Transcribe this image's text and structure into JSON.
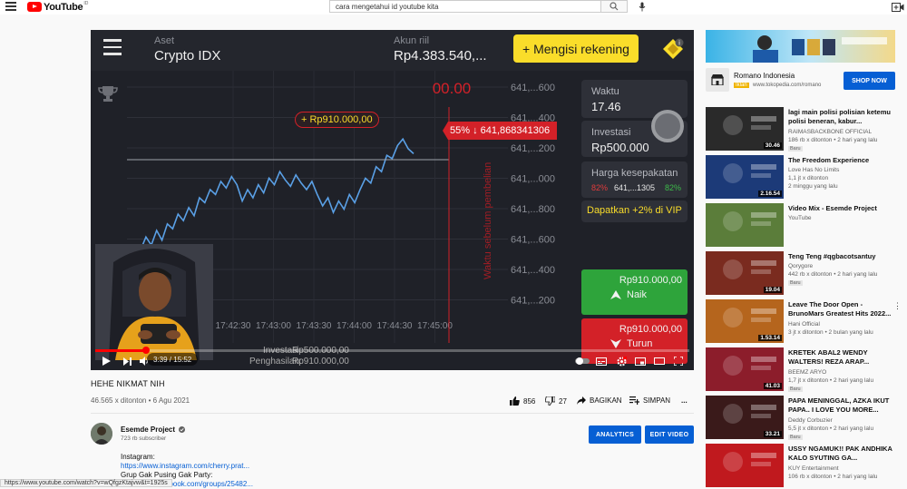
{
  "browser": {
    "status_url": "https://www.youtube.com/watch?v=wQfgzKtajvw&t=1925s"
  },
  "header": {
    "logo_text": "YouTube",
    "logo_sup": "ID",
    "search_value": "cara mengetahui id youtube kita"
  },
  "player": {
    "app": {
      "asset_label": "Aset",
      "asset_value": "Crypto IDX",
      "account_label": "Akun riil",
      "account_value": "Rp4.383.540,...",
      "deposit_button": "+ Mengisi rekening",
      "timer_text": "00.00",
      "y_ticks": [
        "641,...600",
        "641,...400",
        "641,...200",
        "641,...000",
        "641,...800",
        "641,...600",
        "641,...400",
        "641,...200"
      ],
      "x_ticks": [
        "17:42:30",
        "17:43:00",
        "17:43:30",
        "17:44:00",
        "17:44:30",
        "17:45:00"
      ],
      "entry_tag": "+ Rp910.000,00",
      "price_tag": "55% ↓ 641,868341306",
      "vertical_label": "Waktu sebelum pembelian",
      "time_label": "Waktu",
      "time_value": "17.46",
      "invest_label": "Investasi",
      "invest_value": "Rp500.000",
      "agreement_label": "Harga kesepakatan",
      "agreement_left_pct": "82%",
      "agreement_mid": "641,...1305",
      "agreement_right_pct": "82%",
      "vip_text": "Dapatkan +2% di VIP",
      "up_amount": "Rp910.000,00",
      "up_label": "Naik",
      "down_amount": "Rp910.000,00",
      "down_label": "Turun",
      "invest_row_label": "Investasi:",
      "invest_row_value": "Rp500.000,00",
      "payout_row_label": "Penghasilan:",
      "payout_row_value": "Rp910.000,00"
    },
    "time_display": "3:39 / 15:52",
    "progress_fraction": 0.23
  },
  "video": {
    "title": "HEHE NIKMAT NIH",
    "meta": "46.565 x ditonton • 6 Agu 2021",
    "likes": "856",
    "dislikes": "27",
    "share_label": "BAGIKAN",
    "save_label": "SIMPAN",
    "more_label": "..."
  },
  "channel": {
    "name": "Esemde Project",
    "subscribers": "723 rb subscriber",
    "analytics_button": "ANALYTICS",
    "edit_button": "EDIT VIDEO",
    "desc_line1": "Instagram:",
    "desc_link1": "https://www.instagram.com/cherry.prat...",
    "desc_line2": "Grup Gak Pusing Gak Party:",
    "desc_link2": "cebook.com/groups/25482..."
  },
  "ad": {
    "title": "Romano Indonesia",
    "tag": "Iklan",
    "url": "www.tokopedia.com/romano",
    "button": "SHOP NOW"
  },
  "recommendations": [
    {
      "title": "lagi main polisi polisian ketemu polisi beneran, kabur...",
      "channel": "RAIMASBACKBONE OFFICIAL",
      "views": "186 rb x ditonton • 2 hari yang lalu",
      "badge": "Baru",
      "duration": "30.46",
      "thumb_bg": "#2a2a2a"
    },
    {
      "title": "The Freedom Experience",
      "channel": "Love Has No Limits",
      "views": "1,1 jt x ditonton",
      "views2": "2 minggu yang lalu",
      "duration": "2.16.54",
      "thumb_bg": "#1c3a78"
    },
    {
      "title": "Video Mix - Esemde Project",
      "channel": "YouTube",
      "views": "",
      "duration": "",
      "thumb_bg": "#5b7d3a"
    },
    {
      "title": "Teng Teng #qgbacotsantuy",
      "channel": "Qorygore",
      "views": "442 rb x ditonton • 2 hari yang lalu",
      "badge": "Baru",
      "duration": "19.04",
      "thumb_bg": "#7a2b1f"
    },
    {
      "title": "Leave The Door Open - BrunoMars Greatest Hits 2022...",
      "channel": "Hani Official",
      "views": "3 jt x ditonton • 2 bulan yang lalu",
      "duration": "1.53.14",
      "thumb_bg": "#b5651d"
    },
    {
      "title": "KRETEK ABAL2 WENDY WALTERS! REZA ARAP...",
      "channel": "BEEMZ ARYO",
      "views": "1,7 jt x ditonton • 2 hari yang lalu",
      "badge": "Baru",
      "duration": "41.03",
      "thumb_bg": "#8c1d2b"
    },
    {
      "title": "PAPA MENINGGAL, AZKA IKUT PAPA.. I LOVE YOU MORE...",
      "channel": "Deddy Corbuzier",
      "views": "5,5 jt x ditonton • 2 hari yang lalu",
      "badge": "Baru",
      "duration": "33.21",
      "thumb_bg": "#3a1a1a"
    },
    {
      "title": "USSY NGAMUK!! PAK ANDHIKA KALO SYUTING GA...",
      "channel": "KUY Entertainment",
      "views": "106 rb x ditonton • 2 hari yang lalu",
      "duration": "",
      "thumb_bg": "#c0191e"
    }
  ],
  "colors": {
    "brand_red": "#ff0000",
    "link_blue": "#065fd4",
    "deposit_yellow": "#fadd2a",
    "up_green": "#2ea43b",
    "down_red": "#d32128",
    "chart_line": "#5aa0e6"
  },
  "chart_data": {
    "type": "line",
    "x_ticks": [
      "17:42:30",
      "17:43:00",
      "17:43:30",
      "17:44:00",
      "17:44:30",
      "17:45:00"
    ],
    "y_tick_labels": [
      "641,...600",
      "641,...400",
      "641,...200",
      "641,...000",
      "641,...800",
      "641,...600",
      "641,...400",
      "641,...200"
    ],
    "values": [
      0.18,
      0.26,
      0.21,
      0.3,
      0.24,
      0.34,
      0.31,
      0.4,
      0.36,
      0.44,
      0.39,
      0.5,
      0.47,
      0.55,
      0.52,
      0.6,
      0.56,
      0.63,
      0.58,
      0.48,
      0.55,
      0.5,
      0.58,
      0.53,
      0.62,
      0.58,
      0.66,
      0.61,
      0.57,
      0.64,
      0.59,
      0.55,
      0.6,
      0.52,
      0.45,
      0.5,
      0.41,
      0.48,
      0.43,
      0.52,
      0.47,
      0.55,
      0.62,
      0.59,
      0.69,
      0.66,
      0.76,
      0.74,
      0.82,
      0.86,
      0.8,
      0.77
    ],
    "entry_value": 0.8,
    "grid": true
  }
}
